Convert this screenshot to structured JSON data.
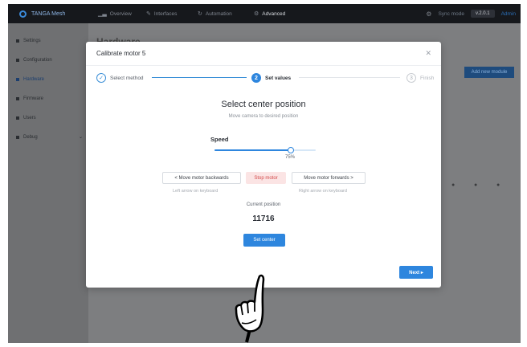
{
  "app": {
    "brand": "TANGA Mesh"
  },
  "nav": {
    "tabs": [
      {
        "label": "Overview",
        "icon": "chart-icon"
      },
      {
        "label": "Interfaces",
        "icon": "wrench-icon"
      },
      {
        "label": "Automation",
        "icon": "refresh-icon"
      },
      {
        "label": "Advanced",
        "icon": "gear-icon",
        "active": true
      }
    ],
    "system_label": "Sync mode",
    "version": "v.2.0.1",
    "user": "Admin"
  },
  "sidebar": {
    "items": [
      {
        "label": "Settings"
      },
      {
        "label": "Configuration"
      },
      {
        "label": "Hardware",
        "active": true
      },
      {
        "label": "Firmware"
      },
      {
        "label": "Users"
      },
      {
        "label": "Debug"
      }
    ]
  },
  "background": {
    "page_title": "Hardware",
    "add_button": "Add new module"
  },
  "modal": {
    "title": "Calibrate motor 5",
    "steps": [
      {
        "number": "✓",
        "label": "Select method",
        "state": "done"
      },
      {
        "number": "2",
        "label": "Set values",
        "state": "current"
      },
      {
        "number": "3",
        "label": "Finish",
        "state": "todo"
      }
    ],
    "section_title": "Select center position",
    "section_subtitle": "Move camera to desired position",
    "speed": {
      "label": "Speed",
      "value_percent": 75,
      "value_text": "75%"
    },
    "buttons": {
      "backward": "< Move motor backwards",
      "stop": "Stop motor",
      "forward": "Move motor forwards >",
      "set_center": "Set center",
      "next": "Next ▸"
    },
    "hints": {
      "backward": "Left arrow on keyboard",
      "forward": "Right arrow on keyboard"
    },
    "current_position": {
      "label": "Current position",
      "value": "11716"
    }
  },
  "colors": {
    "accent": "#2e86de",
    "topbar": "#16181c",
    "danger_bg": "#fbe4e4",
    "danger_text": "#d34a4a"
  }
}
